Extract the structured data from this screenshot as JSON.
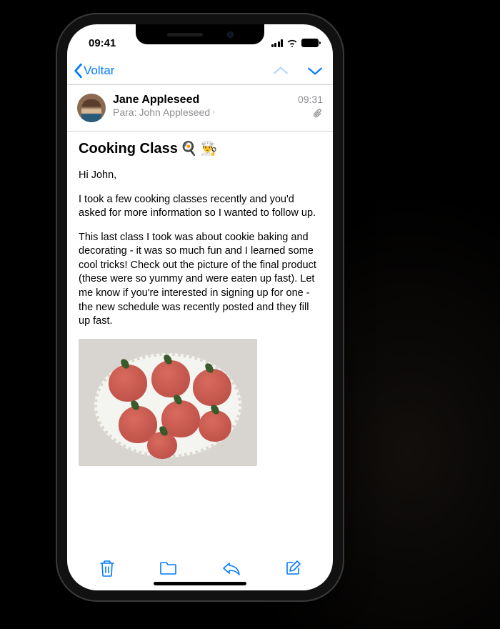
{
  "status_bar": {
    "time": "09:41"
  },
  "nav": {
    "back_label": "Voltar"
  },
  "email": {
    "sender_name": "Jane Appleseed",
    "to_label": "Para:",
    "recipient_name": "John Appleseed",
    "timestamp": "09:31",
    "subject": "Cooking Class",
    "subject_emoji_1": "🍳",
    "subject_emoji_2": "👨‍🍳",
    "greeting": "Hi John,",
    "para1": "I took a few cooking classes recently and you'd asked for more information so I wanted to follow up.",
    "para2": "This last class I took was about cookie baking and decorating - it was so much fun and I learned some cool tricks! Check out the picture of the final product (these were so yummy and were eaten up fast). Let me know if you're interested in signing up for one - the new schedule was recently posted and they fill up fast."
  },
  "toolbar": {
    "trash": "trash",
    "folder": "folder",
    "reply": "reply",
    "compose": "compose"
  }
}
